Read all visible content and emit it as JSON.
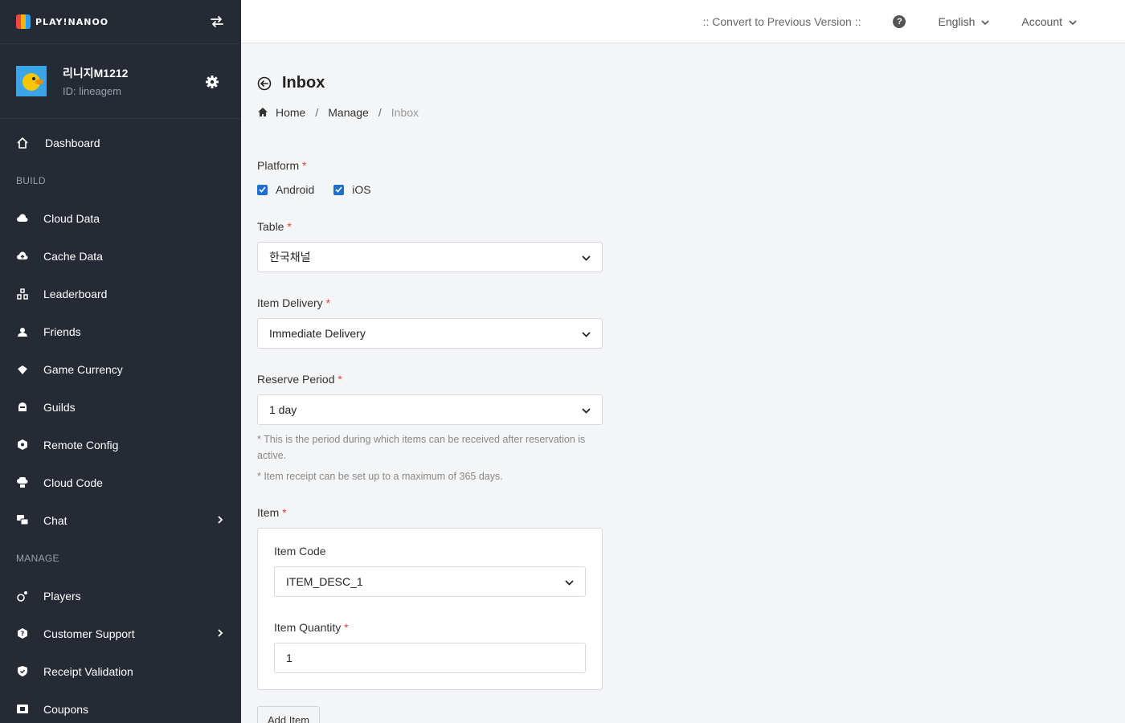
{
  "brand": {
    "logo_text": "PLAY!NANOO"
  },
  "project": {
    "name": "리니지M1212",
    "id": "ID: lineagem"
  },
  "sidebar": {
    "dashboard": "Dashboard",
    "section_build": "BUILD",
    "build_items": [
      {
        "label": "Cloud Data"
      },
      {
        "label": "Cache Data"
      },
      {
        "label": "Leaderboard"
      },
      {
        "label": "Friends"
      },
      {
        "label": "Game Currency"
      },
      {
        "label": "Guilds"
      },
      {
        "label": "Remote Config"
      },
      {
        "label": "Cloud Code"
      },
      {
        "label": "Chat"
      }
    ],
    "section_manage": "MANAGE",
    "manage_items": [
      {
        "label": "Players"
      },
      {
        "label": "Customer Support"
      },
      {
        "label": "Receipt Validation"
      },
      {
        "label": "Coupons"
      }
    ]
  },
  "topbar": {
    "convert_link": ":: Convert to Previous Version ::",
    "help_glyph": "?",
    "language": "English",
    "account": "Account"
  },
  "page": {
    "title": "Inbox",
    "breadcrumb": [
      "Home",
      "Manage",
      "Inbox"
    ],
    "breadcrumb_sep": "/"
  },
  "form": {
    "required_mark": "*",
    "platform_label": "Platform",
    "platform_options": [
      {
        "label": "Android",
        "checked": true
      },
      {
        "label": "iOS",
        "checked": true
      }
    ],
    "table_label": "Table",
    "table_value": "한국채널",
    "delivery_label": "Item Delivery",
    "delivery_value": "Immediate Delivery",
    "reserve_label": "Reserve Period",
    "reserve_value": "1 day",
    "reserve_hint1": "* This is the period during which items can be received after reservation is active.",
    "reserve_hint2": "* Item receipt can be set up to a maximum of 365 days.",
    "item_label": "Item",
    "item_code_label": "Item Code",
    "item_code_value": "ITEM_DESC_1",
    "item_qty_label": "Item Quantity",
    "item_qty_value": "1",
    "add_item_button": "Add Item"
  },
  "colors": {
    "sidebar_bg": "#252a35",
    "accent": "#1f6fd1",
    "required": "#e0443a"
  }
}
